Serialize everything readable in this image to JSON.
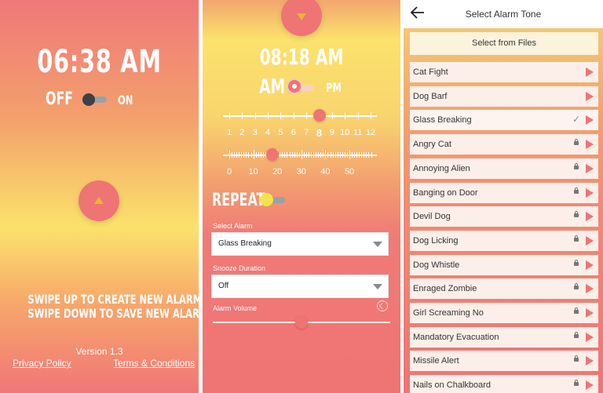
{
  "screen1": {
    "time": "06:38 AM",
    "off_label": "OFF",
    "on_label": "ON",
    "toggle_state": "off",
    "swipe_up_text": "SWIPE UP TO CREATE NEW ALARM",
    "swipe_down_text": "SWIPE DOWN TO SAVE NEW ALARM",
    "version": "Version 1.3",
    "privacy_link": "Privacy Policy",
    "terms_link": "Terms & Conditions"
  },
  "screen2": {
    "time": "08:18 AM",
    "am_label": "AM",
    "pm_label": "PM",
    "hour_slider": {
      "labels": [
        "1",
        "2",
        "3",
        "4",
        "5",
        "6",
        "7",
        "8",
        "9",
        "10",
        "11",
        "12"
      ],
      "value": 8
    },
    "minute_slider": {
      "labels": [
        "0",
        "10",
        "20",
        "30",
        "40",
        "50"
      ],
      "value": 18
    },
    "repeat_label": "REPEAT",
    "select_alarm_label": "Select Alarm",
    "select_alarm_value": "Glass Breaking",
    "snooze_label": "Snooze Duration",
    "snooze_value": "Off",
    "volume_label": "Alarm Volume",
    "volume_value": 0.5
  },
  "screen3": {
    "title": "Select Alarm Tone",
    "select_files_label": "Select from Files",
    "tones": [
      {
        "name": "Cat Fight",
        "locked": false,
        "selected": false
      },
      {
        "name": "Dog Barf",
        "locked": false,
        "selected": false
      },
      {
        "name": "Glass Breaking",
        "locked": false,
        "selected": true
      },
      {
        "name": "Angry Cat",
        "locked": true,
        "selected": false
      },
      {
        "name": "Annoying Alien",
        "locked": true,
        "selected": false
      },
      {
        "name": "Banging on Door",
        "locked": true,
        "selected": false
      },
      {
        "name": "Devil Dog",
        "locked": true,
        "selected": false
      },
      {
        "name": "Dog Licking",
        "locked": true,
        "selected": false
      },
      {
        "name": "Dog Whistle",
        "locked": true,
        "selected": false
      },
      {
        "name": "Enraged Zombie",
        "locked": true,
        "selected": false
      },
      {
        "name": "Girl Screaming No",
        "locked": true,
        "selected": false
      },
      {
        "name": "Mandatory Evacuation",
        "locked": true,
        "selected": false
      },
      {
        "name": "Missile Alert",
        "locked": true,
        "selected": false
      },
      {
        "name": "Nails on Chalkboard",
        "locked": true,
        "selected": false
      }
    ]
  },
  "colors": {
    "coral": "#ef7474",
    "yellow": "#fbe26c",
    "toggle_yellow": "#f4e14e"
  },
  "icons": {
    "back": "arrow-left-icon",
    "play": "play-icon",
    "lock": "lock-icon",
    "check": "check-icon",
    "volume": "volume-icon"
  }
}
